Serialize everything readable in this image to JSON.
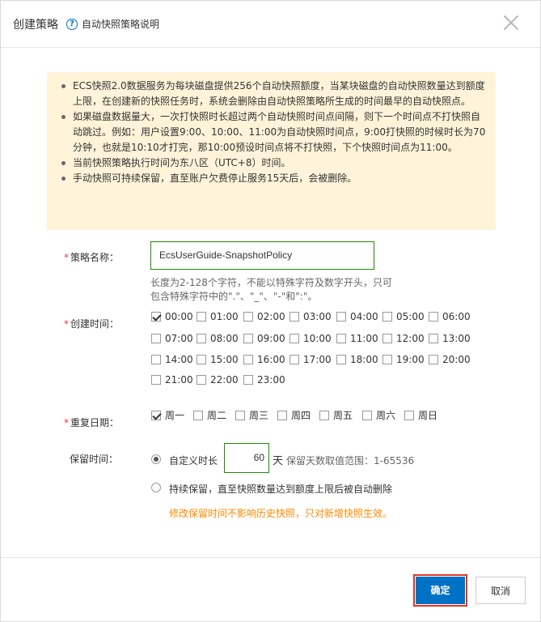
{
  "dialog": {
    "title": "创建策略",
    "help_link": "自动快照策略说明",
    "help_icon": "question-circle-icon",
    "close_icon": "close-icon"
  },
  "notice": {
    "items": [
      "ECS快照2.0数据服务为每块磁盘提供256个自动快照额度，当某块磁盘的自动快照数量达到额度上限，在创建新的快照任务时，系统会删除由自动快照策略所生成的时间最早的自动快照点。",
      "如果磁盘数据量大，一次打快照时长超过两个自动快照时间点间隔，则下一个时间点不打快照自动跳过。例如：用户设置9:00、10:00、11:00为自动快照时间点，9:00打快照的时候时长为70分钟，也就是10:10才打完，那10:00预设时间点将不打快照，下个快照时间点为11:00。",
      "当前快照策略执行时间为东八区（UTC+8）时间。",
      "手动快照可持续保留，直至账户欠费停止服务15天后，会被删除。"
    ]
  },
  "form": {
    "name_label": "策略名称：",
    "name_value": "EcsUserGuide-SnapshotPolicy",
    "name_hint": "长度为2-128个字符，不能以特殊字符及数字开头，只可包含特殊字符中的\".\"、\"_\"、\"-\"和\":\"。",
    "time_label": "创建时间：",
    "times": [
      "00:00",
      "01:00",
      "02:00",
      "03:00",
      "04:00",
      "05:00",
      "06:00",
      "07:00",
      "08:00",
      "09:00",
      "10:00",
      "11:00",
      "12:00",
      "13:00",
      "14:00",
      "15:00",
      "16:00",
      "17:00",
      "18:00",
      "19:00",
      "20:00",
      "21:00",
      "22:00",
      "23:00"
    ],
    "times_checked": [
      "00:00"
    ],
    "repeat_label": "重复日期：",
    "days": [
      "周一",
      "周二",
      "周三",
      "周四",
      "周五",
      "周六",
      "周日"
    ],
    "days_checked": [
      "周一"
    ],
    "retain_label": "保留时间：",
    "custom_label": "自定义时长",
    "custom_days": "60",
    "days_unit": "天",
    "range_text": "保留天数取值范围：1-65536",
    "forever_label": "持续保留，直至快照数量达到额度上限后被自动删除",
    "warning": "修改保留时间不影响历史快照，只对新增快照生效。"
  },
  "footer": {
    "ok_label": "确定",
    "cancel_label": "取消"
  }
}
